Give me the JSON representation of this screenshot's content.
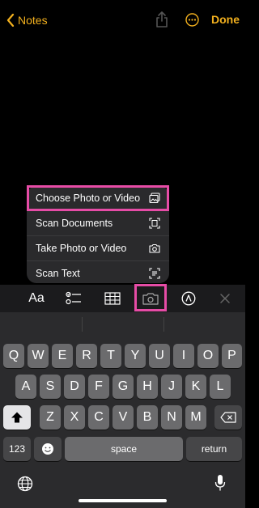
{
  "nav": {
    "back_label": "Notes",
    "done_label": "Done"
  },
  "menu": {
    "items": [
      {
        "label": "Choose Photo or Video",
        "icon": "photo-library-icon"
      },
      {
        "label": "Scan Documents",
        "icon": "scan-document-icon"
      },
      {
        "label": "Take Photo or Video",
        "icon": "camera-icon"
      },
      {
        "label": "Scan Text",
        "icon": "scan-text-icon"
      }
    ]
  },
  "toolbar": {
    "format_label": "Aa"
  },
  "keyboard": {
    "row1": [
      "Q",
      "W",
      "E",
      "R",
      "T",
      "Y",
      "U",
      "I",
      "O",
      "P"
    ],
    "row2": [
      "A",
      "S",
      "D",
      "F",
      "G",
      "H",
      "J",
      "K",
      "L"
    ],
    "row3": [
      "Z",
      "X",
      "C",
      "V",
      "B",
      "N",
      "M"
    ],
    "numbers_label": "123",
    "space_label": "space",
    "return_label": "return"
  },
  "colors": {
    "accent": "#f2b01e",
    "highlight": "#e64ca6"
  }
}
